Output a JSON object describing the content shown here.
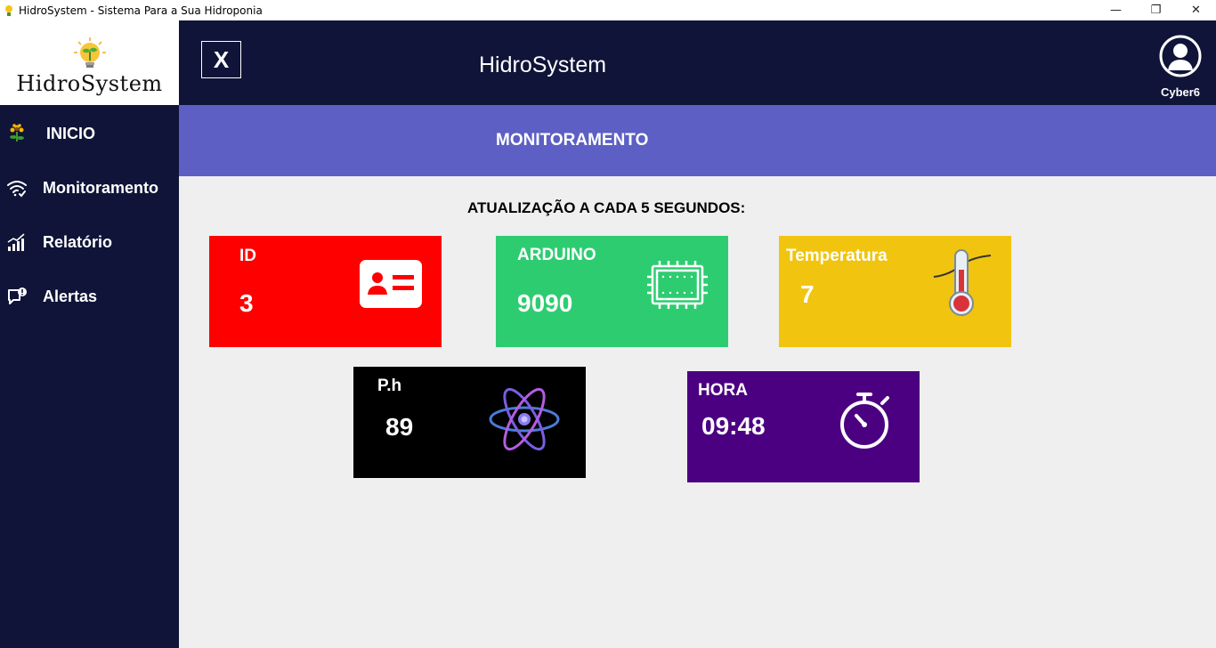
{
  "window": {
    "title": "HidroSystem - Sistema Para a Sua Hidroponia",
    "minimize_glyph": "—",
    "restore_glyph": "❐",
    "close_glyph": "✕"
  },
  "logo": {
    "text": "HidroSystem",
    "icon": "lightbulb-plant-icon"
  },
  "sidebar": {
    "items": [
      {
        "label": "INICIO",
        "icon": "sunflower-icon"
      },
      {
        "label": "Monitoramento",
        "icon": "wifi-check-icon"
      },
      {
        "label": "Relatório",
        "icon": "chart-bars-icon"
      },
      {
        "label": "Alertas",
        "icon": "chat-alert-icon"
      }
    ]
  },
  "header": {
    "close_label": "X",
    "title": "HidroSystem",
    "user_name": "Cyber6",
    "user_icon": "user-avatar-icon"
  },
  "subheader": {
    "title": "MONITORAMENTO"
  },
  "update_note": "ATUALIZAÇÃO A CADA 5 SEGUNDOS:",
  "cards": {
    "id": {
      "label": "ID",
      "value": "3",
      "color": "#ff0000",
      "icon": "id-card-icon"
    },
    "arduino": {
      "label": "ARDUINO",
      "value": "9090",
      "color": "#2ecc71",
      "icon": "circuit-board-icon"
    },
    "temperatura": {
      "label": "Temperatura",
      "value": "7",
      "color": "#f1c40f",
      "icon": "thermometer-icon"
    },
    "ph": {
      "label": "P.h",
      "value": "89",
      "color": "#000000",
      "icon": "atom-icon"
    },
    "hora": {
      "label": "HORA",
      "value": "09:48",
      "color": "#4b0082",
      "icon": "stopwatch-icon"
    }
  }
}
